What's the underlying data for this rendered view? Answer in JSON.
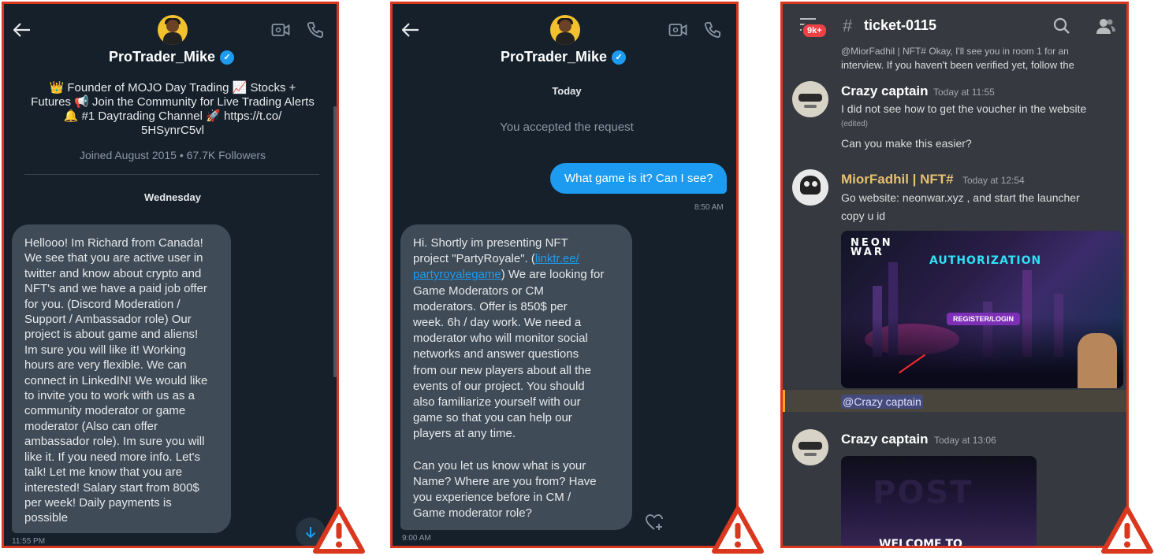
{
  "panel1": {
    "name": "ProTrader_Mike",
    "bio_lines": [
      "👑 Founder of MOJO Day Trading 📈 Stocks +",
      "Futures 📢 Join the Community for Live Trading Alerts",
      "🔔 #1 Daytrading Channel 🚀 https://t.co/",
      "5HSynrC5vl"
    ],
    "joined": "Joined August 2015 • 67.7K Followers",
    "day": "Wednesday",
    "message_lines": [
      "Hellooo! Im Richard from Canada!",
      "We see that you are active user in",
      "twitter and know about crypto and",
      "NFT's and we have a paid job offer",
      "for you. (Discord Moderation /",
      "Support / Ambassador role) Our",
      "project is about game and aliens!",
      "Im sure you will like it! Working",
      "hours are very flexible. We can",
      "connect in LinkedIN! We would like",
      "to invite you to work with us as a",
      "community moderator or game",
      "moderator (Also can offer",
      "ambassador role). Im sure you will",
      "like it. If you need more info. Let's",
      "talk! Let me know that you are",
      "interested! Salary start from 800$",
      "per week! Daily payments is",
      "possible"
    ],
    "time": "11:55 PM"
  },
  "panel2": {
    "name": "ProTrader_Mike",
    "day": "Today",
    "accepted": "You accepted the request",
    "outgoing": "What game is it? Can I see?",
    "outgoing_time": "8:50 AM",
    "msg": {
      "l1": "Hi. Shortly im presenting NFT",
      "l2_pre": "project \"PartyRoyale\". (",
      "l2_link": "linktr.ee/",
      "l3_link": "partyroyalegame",
      "l3_post": ") We are looking for",
      "rest": [
        "Game Moderators or CM",
        "moderators. Offer is 850$ per",
        "week. 6h / day work. We need a",
        "moderator who will monitor social",
        "networks and answer questions",
        "from our new players about all the",
        "events of our project. You should",
        "also familiarize yourself with our",
        "game so that you can help our",
        "players at any time.",
        "",
        "Can you let us know what is your",
        "Name? Where are you from? Have",
        "you experience before in CM /",
        "Game moderator role?"
      ]
    },
    "time": "9:00 AM"
  },
  "panel3": {
    "badge": "9k+",
    "channel": "ticket-0115",
    "cutoff_top": "@MiorFadhil | NFT# Okay, I'll see you in room 1 for an",
    "cutoff_text": "interview. If you haven't been verified yet, follow the",
    "messages": [
      {
        "author": "Crazy captain",
        "time": "Today at 11:55",
        "lines": [
          "I did not see how to get the voucher in the website"
        ],
        "edited": "(edited)",
        "extra": "Can you make this easier?"
      },
      {
        "author": "MiorFadhil | NFT#",
        "time": "Today at 12:54",
        "lines": [
          "Go website: neonwar.xyz , and start the launcher",
          "copy u id"
        ]
      },
      {
        "author": "Crazy captain",
        "time": "Today at 13:06"
      }
    ],
    "image1": {
      "logo_line1": "NEON",
      "logo_line2": "WAR",
      "title": "AUTHORIZATION",
      "button": "REGISTER/LOGIN"
    },
    "mention": "@Crazy captain",
    "image2": {
      "big": "POST",
      "welcome": "WELCOME TO"
    },
    "colors": {
      "author_default": "#ffffff",
      "author_mod": "#e8c070",
      "warning_red": "#d9371e"
    }
  },
  "icons": [
    "back-arrow-icon",
    "video-call-icon",
    "phone-icon",
    "verified-icon",
    "scroll-down-icon",
    "heart-react-icon",
    "hamburger-icon",
    "hash-icon",
    "search-icon",
    "members-icon",
    "warning-icon"
  ]
}
